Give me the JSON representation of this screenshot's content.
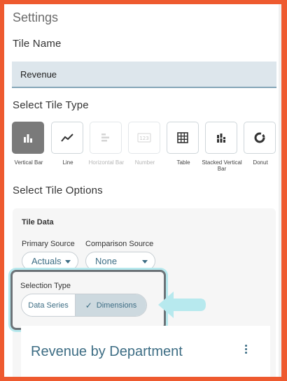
{
  "settings_title": "Settings",
  "tile_name": {
    "label": "Tile Name",
    "value": "Revenue"
  },
  "tile_type": {
    "label": "Select Tile Type",
    "options": [
      {
        "label": "Vertical Bar",
        "icon": "vertical-bar-chart-icon",
        "state": "selected"
      },
      {
        "label": "Line",
        "icon": "line-chart-icon",
        "state": "enabled"
      },
      {
        "label": "Horizontal Bar",
        "icon": "horizontal-bar-chart-icon",
        "state": "disabled"
      },
      {
        "label": "Number",
        "icon": "number-icon",
        "state": "disabled"
      },
      {
        "label": "Table",
        "icon": "table-icon",
        "state": "enabled"
      },
      {
        "label": "Stacked Vertical Bar",
        "icon": "stacked-bar-chart-icon",
        "state": "enabled"
      },
      {
        "label": "Donut",
        "icon": "donut-chart-icon",
        "state": "enabled"
      }
    ]
  },
  "tile_options": {
    "label": "Select Tile Options",
    "card_heading": "Tile Data",
    "primary_source": {
      "label": "Primary Source",
      "value": "Actuals"
    },
    "comparison_source": {
      "label": "Comparison Source",
      "value": "None"
    },
    "selection_type": {
      "label": "Selection Type",
      "options": [
        "Data Series",
        "Dimensions"
      ],
      "selected": "Dimensions"
    }
  },
  "preview": {
    "title": "Revenue by Department"
  },
  "colors": {
    "frame": "#ee5a2f",
    "accent": "#3d6d84",
    "highlight": "#b7e9ee",
    "selected_tile": "#7a7a7a"
  }
}
